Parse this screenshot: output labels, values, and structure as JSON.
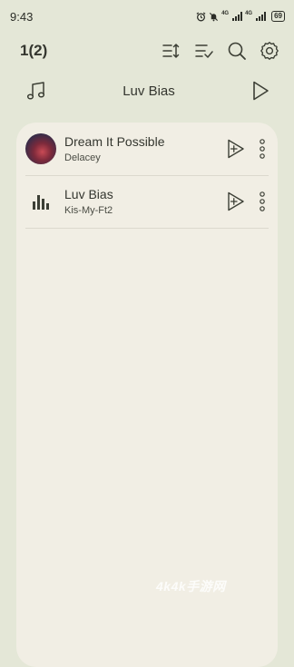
{
  "status_bar": {
    "time": "9:43",
    "network_1": "4G",
    "network_2": "4G",
    "battery": "69"
  },
  "toolbar": {
    "title": "1(2)",
    "icons": [
      "sort-icon",
      "multi-select-icon",
      "search-icon",
      "settings-gear-icon"
    ]
  },
  "now_playing": {
    "title": "Luv Bias",
    "icons": [
      "music-note-icon",
      "play-icon"
    ]
  },
  "songs": [
    {
      "title": "Dream It Possible",
      "artist": "Delacey",
      "thumb": "album-art"
    },
    {
      "title": "Luv Bias",
      "artist": "Kis-My-Ft2",
      "thumb": "equalizer-icon"
    }
  ],
  "watermark": "4k4k手游网",
  "colors": {
    "background": "#e4e7d7",
    "card": "#f1eee4",
    "text": "#34362f"
  }
}
